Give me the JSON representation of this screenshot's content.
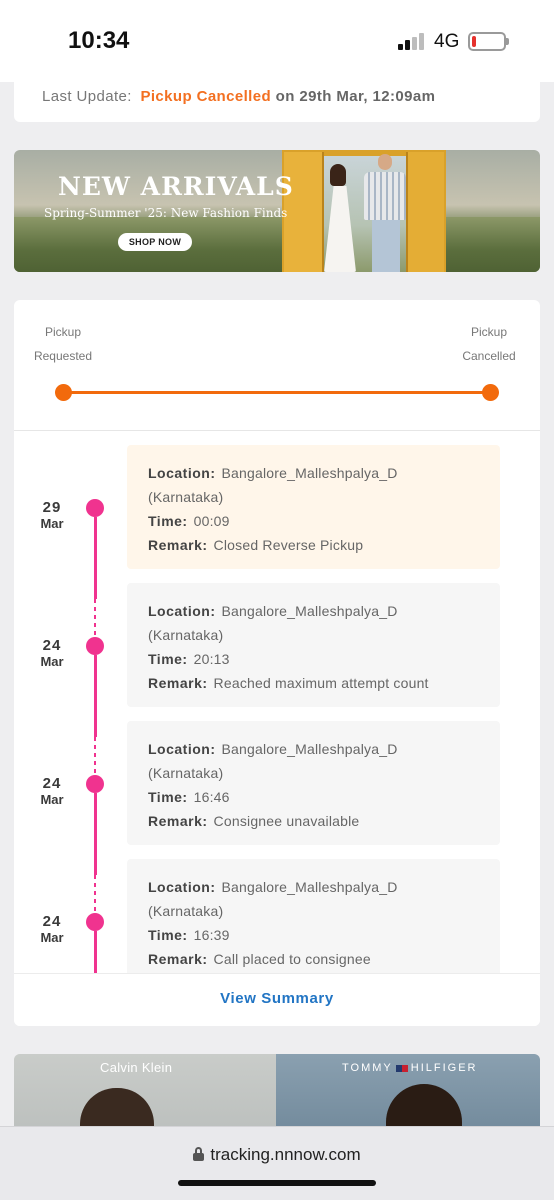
{
  "status_bar": {
    "time": "10:34",
    "network": "4G",
    "signal_bars_active": 2,
    "signal_bars_total": 4,
    "battery_level": 0.08,
    "battery_color": "#e5322d"
  },
  "update": {
    "label": "Last Update:",
    "status": "Pickup Cancelled",
    "time": "on 29th Mar, 12:09am"
  },
  "banner": {
    "title": "NEW ARRIVALS",
    "subtitle": "Spring-Summer '25: New Fashion Finds",
    "button": "SHOP NOW"
  },
  "progress": {
    "start_line1": "Pickup",
    "start_line2": "Requested",
    "end_line1": "Pickup",
    "end_line2": "Cancelled",
    "accent": "#f26a0c"
  },
  "events": [
    {
      "day": "29",
      "month": "Mar",
      "location_key": "Location:",
      "location": "Bangalore_Malleshpalya_D",
      "region": "(Karnataka)",
      "time_key": "Time:",
      "time": "00:09",
      "remark_key": "Remark:",
      "remark": "Closed Reverse Pickup"
    },
    {
      "day": "24",
      "month": "Mar",
      "location_key": "Location:",
      "location": "Bangalore_Malleshpalya_D",
      "region": "(Karnataka)",
      "time_key": "Time:",
      "time": "20:13",
      "remark_key": "Remark:",
      "remark": "Reached maximum attempt count"
    },
    {
      "day": "24",
      "month": "Mar",
      "location_key": "Location:",
      "location": "Bangalore_Malleshpalya_D",
      "region": "(Karnataka)",
      "time_key": "Time:",
      "time": "16:46",
      "remark_key": "Remark:",
      "remark": "Consignee unavailable"
    },
    {
      "day": "24",
      "month": "Mar",
      "location_key": "Location:",
      "location": "Bangalore_Malleshpalya_D",
      "region": "(Karnataka)",
      "time_key": "Time:",
      "time": "16:39",
      "remark_key": "Remark:",
      "remark": "Call placed to consignee"
    }
  ],
  "timeline_color": "#f0338f",
  "summary": {
    "link": "View Summary"
  },
  "brands": {
    "left": "Calvin Klein",
    "right_a": "TOMMY",
    "right_b": "HILFIGER"
  },
  "browser": {
    "url": "tracking.nnnow.com",
    "lock_icon": "lock-icon"
  }
}
